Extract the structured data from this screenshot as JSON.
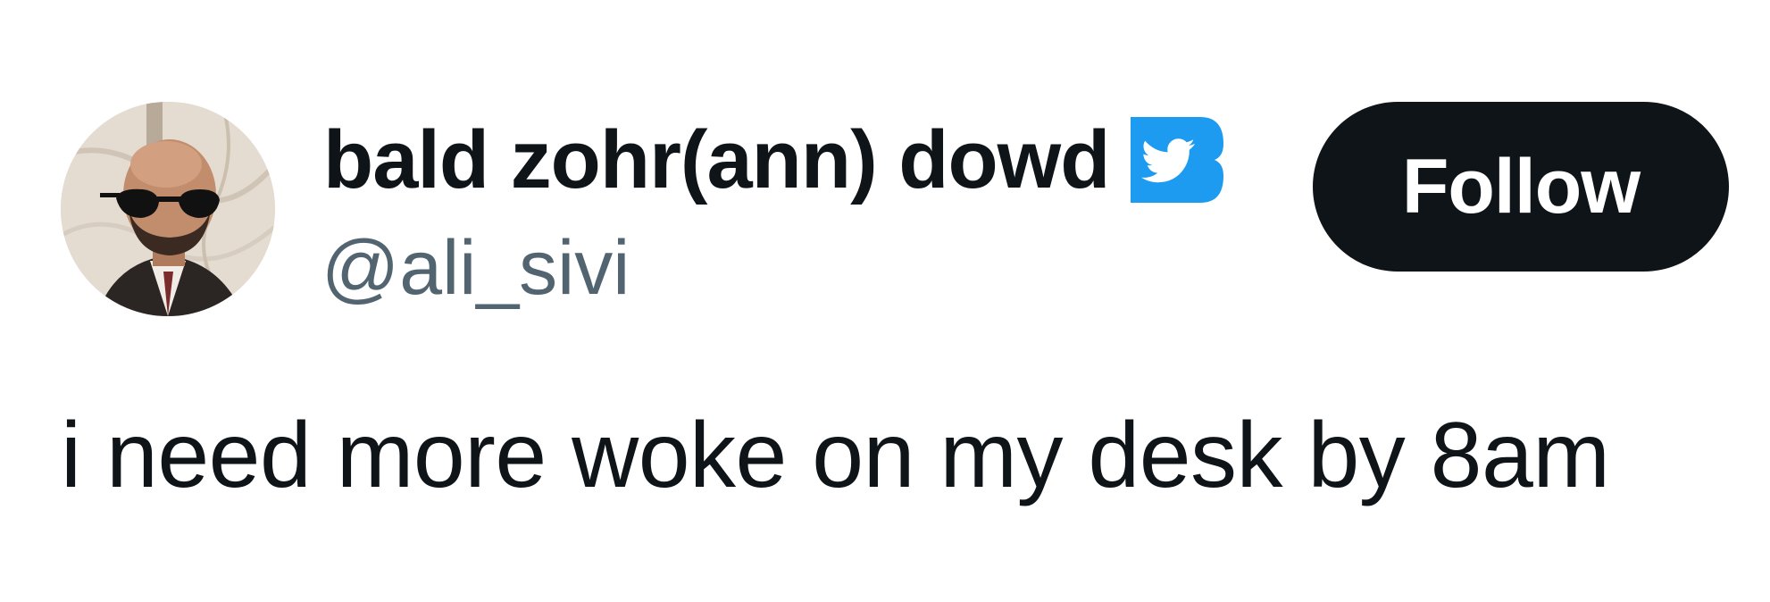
{
  "user": {
    "display_name": "bald zohr(ann) dowd",
    "handle": "@ali_sivi",
    "avatar": "profile-photo",
    "badge_icon": "twitter-bird-badge-icon",
    "badge_color": "#1d9bf0"
  },
  "actions": {
    "follow_label": "Follow",
    "follow_bg": "#0f1419"
  },
  "tweet": {
    "text": "i need more woke on my desk by 8am"
  },
  "colors": {
    "text_primary": "#0f1419",
    "text_secondary": "#536471",
    "background": "#ffffff"
  }
}
